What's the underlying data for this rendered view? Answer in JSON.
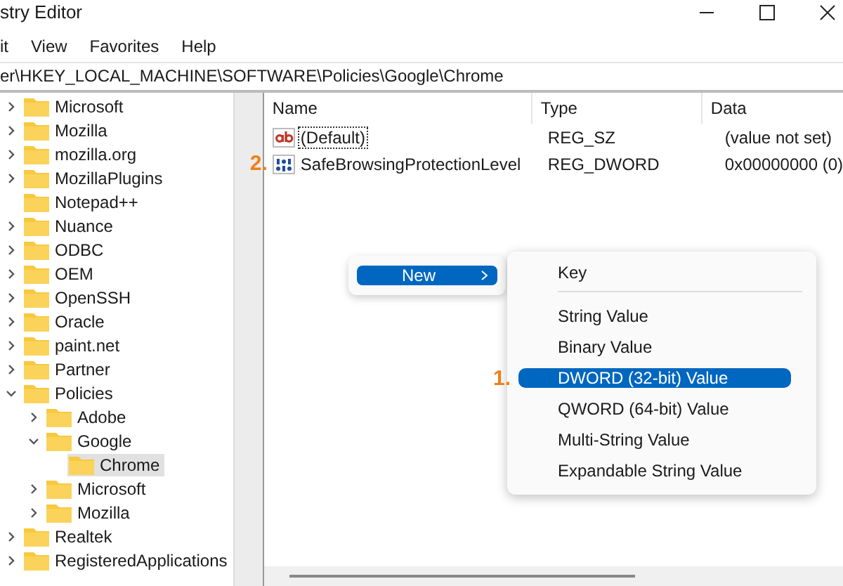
{
  "window": {
    "title": "stry Editor"
  },
  "menu_bar": [
    "it",
    "View",
    "Favorites",
    "Help"
  ],
  "address_bar": {
    "value": "er\\HKEY_LOCAL_MACHINE\\SOFTWARE\\Policies\\Google\\Chrome"
  },
  "tree": [
    {
      "label": "Microsoft",
      "has_subkeys": true,
      "expanded": false,
      "selected": false
    },
    {
      "label": "Mozilla",
      "has_subkeys": true,
      "expanded": false,
      "selected": false
    },
    {
      "label": "mozilla.org",
      "has_subkeys": true,
      "expanded": false,
      "selected": false
    },
    {
      "label": "MozillaPlugins",
      "has_subkeys": true,
      "expanded": false,
      "selected": false
    },
    {
      "label": "Notepad++",
      "has_subkeys": false,
      "selected": false
    },
    {
      "label": "Nuance",
      "has_subkeys": true,
      "expanded": false,
      "selected": false
    },
    {
      "label": "ODBC",
      "has_subkeys": true,
      "expanded": false,
      "selected": false
    },
    {
      "label": "OEM",
      "has_subkeys": true,
      "expanded": false,
      "selected": false
    },
    {
      "label": "OpenSSH",
      "has_subkeys": true,
      "expanded": false,
      "selected": false
    },
    {
      "label": "Oracle",
      "has_subkeys": true,
      "expanded": false,
      "selected": false
    },
    {
      "label": "paint.net",
      "has_subkeys": true,
      "expanded": false,
      "selected": false
    },
    {
      "label": "Partner",
      "has_subkeys": true,
      "expanded": false,
      "selected": false
    },
    {
      "label": "Policies",
      "has_subkeys": true,
      "expanded": true,
      "selected": false,
      "children": [
        {
          "label": "Adobe",
          "has_subkeys": true,
          "expanded": false,
          "selected": false
        },
        {
          "label": "Google",
          "has_subkeys": true,
          "expanded": true,
          "selected": false,
          "children": [
            {
              "label": "Chrome",
              "has_subkeys": false,
              "selected": true
            }
          ]
        },
        {
          "label": "Microsoft",
          "has_subkeys": true,
          "expanded": false,
          "selected": false
        },
        {
          "label": "Mozilla",
          "has_subkeys": true,
          "expanded": false,
          "selected": false
        }
      ]
    },
    {
      "label": "Realtek",
      "has_subkeys": true,
      "expanded": false,
      "selected": false
    },
    {
      "label": "RegisteredApplications",
      "has_subkeys": true,
      "expanded": false,
      "selected": false
    }
  ],
  "values_table": {
    "columns": [
      "Name",
      "Type",
      "Data"
    ],
    "rows": [
      {
        "kind": "string",
        "name": "(Default)",
        "type": "REG_SZ",
        "data": "(value not set)",
        "focused": true
      },
      {
        "kind": "binary",
        "name": "SafeBrowsingProtectionLevel",
        "type": "REG_DWORD",
        "data": "0x00000000 (0)",
        "focused": false,
        "step": "2."
      }
    ]
  },
  "context_menu": {
    "items": [
      {
        "label": "New",
        "selected": true
      }
    ]
  },
  "submenu": {
    "items": [
      {
        "label": "Key",
        "selected": false,
        "separator_after": true
      },
      {
        "label": "String Value",
        "selected": false,
        "separator_after": false
      },
      {
        "label": "Binary Value",
        "selected": false,
        "separator_after": false
      },
      {
        "label": "DWORD (32-bit) Value",
        "selected": true,
        "separator_after": false,
        "step": "1."
      },
      {
        "label": "QWORD (64-bit) Value",
        "selected": false,
        "separator_after": false
      },
      {
        "label": "Multi-String Value",
        "selected": false,
        "separator_after": false
      },
      {
        "label": "Expandable String Value",
        "selected": false,
        "separator_after": false
      }
    ]
  }
}
